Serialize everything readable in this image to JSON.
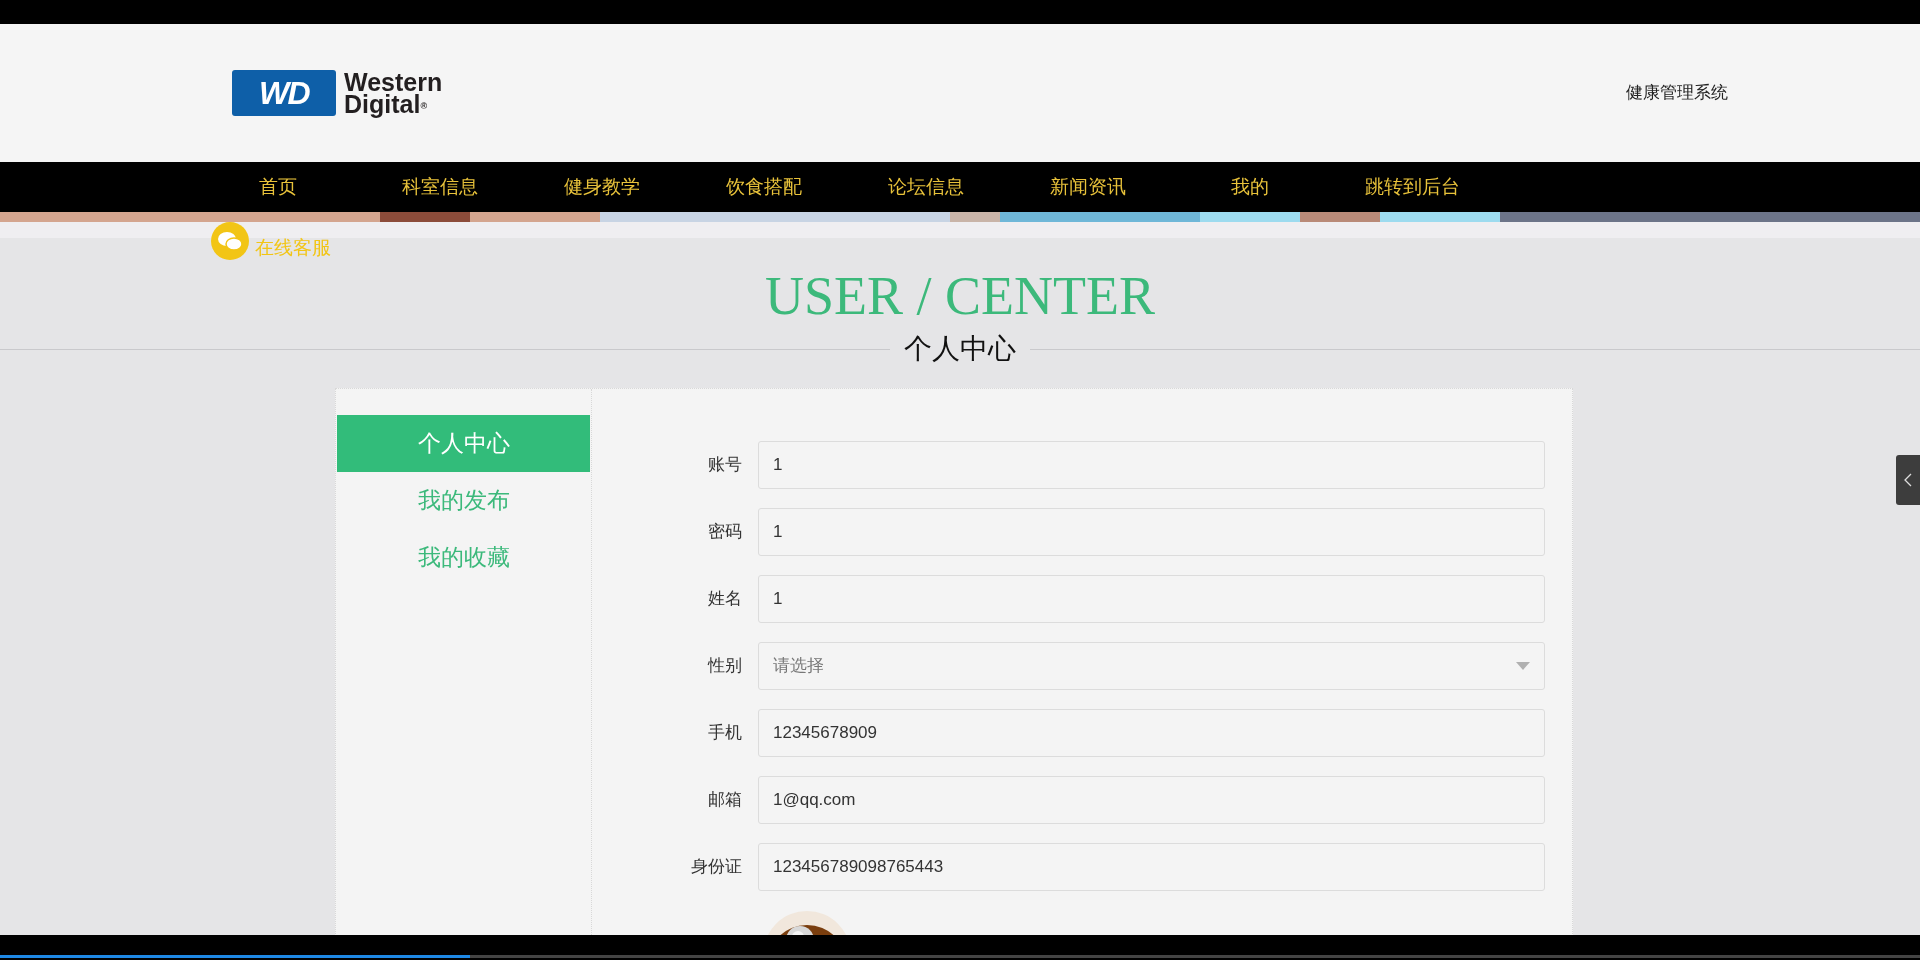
{
  "header": {
    "logo": {
      "mark": "WD",
      "line1": "Western",
      "line2": "Digital",
      "symbol": "®"
    },
    "site_title": "健康管理系统"
  },
  "nav": [
    {
      "label": "首页"
    },
    {
      "label": "科室信息"
    },
    {
      "label": "健身教学"
    },
    {
      "label": "饮食搭配"
    },
    {
      "label": "论坛信息"
    },
    {
      "label": "新闻资讯"
    },
    {
      "label": "我的"
    },
    {
      "label": "跳转到后台"
    }
  ],
  "online_service": {
    "label": "在线客服"
  },
  "page_heading": {
    "title": "USER / CENTER",
    "subtitle": "个人中心"
  },
  "sidebar": [
    {
      "label": "个人中心",
      "selected": true
    },
    {
      "label": "我的发布",
      "selected": false
    },
    {
      "label": "我的收藏",
      "selected": false
    }
  ],
  "form": [
    {
      "label": "账号",
      "kind": "text",
      "value": "1"
    },
    {
      "label": "密码",
      "kind": "text",
      "value": "1"
    },
    {
      "label": "姓名",
      "kind": "text",
      "value": "1"
    },
    {
      "label": "性别",
      "kind": "select",
      "placeholder": "请选择"
    },
    {
      "label": "手机",
      "kind": "text",
      "value": "12345678909"
    },
    {
      "label": "邮箱",
      "kind": "text",
      "value": "1@qq.com"
    },
    {
      "label": "身份证",
      "kind": "text",
      "value": "123456789098765443"
    }
  ],
  "player": {
    "level": 0.245
  }
}
